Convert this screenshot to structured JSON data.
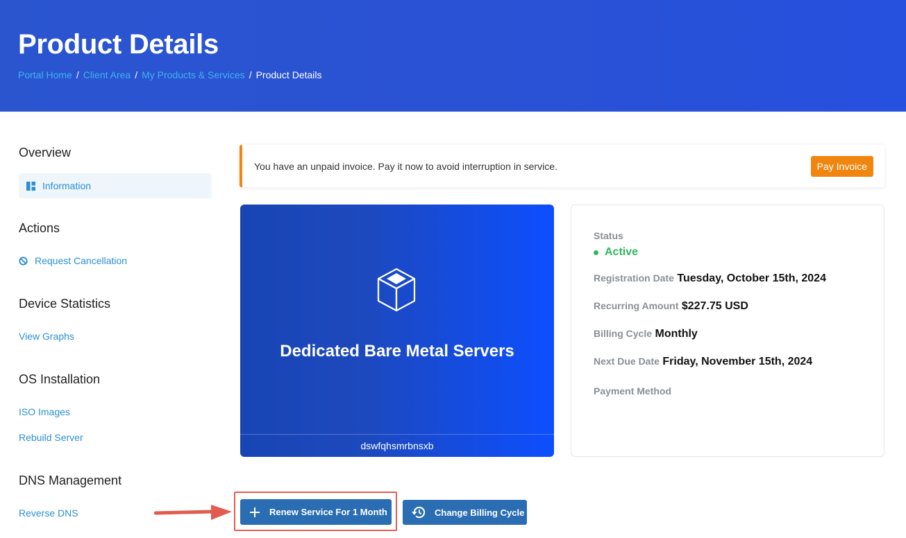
{
  "header": {
    "title": "Product Details",
    "breadcrumb": {
      "links": [
        "Portal Home",
        "Client Area",
        "My Products & Services"
      ],
      "current": "Product Details",
      "separator": "/"
    }
  },
  "sidebar": {
    "overview": {
      "heading": "Overview",
      "items": [
        {
          "label": "Information",
          "icon": "dashboard-icon"
        }
      ]
    },
    "actions": {
      "heading": "Actions",
      "items": [
        {
          "label": "Request Cancellation",
          "icon": "ban-icon"
        }
      ]
    },
    "device_statistics": {
      "heading": "Device Statistics",
      "items": [
        {
          "label": "View Graphs"
        }
      ]
    },
    "os_installation": {
      "heading": "OS Installation",
      "items": [
        {
          "label": "ISO Images"
        },
        {
          "label": "Rebuild Server"
        }
      ]
    },
    "dns_management": {
      "heading": "DNS Management",
      "items": [
        {
          "label": "Reverse DNS"
        }
      ]
    }
  },
  "alert": {
    "message": "You have an unpaid invoice. Pay it now to avoid interruption in service.",
    "button_label": "Pay Invoice",
    "accent_color": "#f0860f"
  },
  "product": {
    "name": "Dedicated Bare Metal Servers",
    "hostname": "dswfqhsmrbnsxb",
    "icon": "cube-icon"
  },
  "details": {
    "status_label": "Status",
    "status_value": "Active",
    "status_color": "#2eb85c",
    "registration_label": "Registration Date",
    "registration_value": "Tuesday, October 15th, 2024",
    "recurring_label": "Recurring Amount",
    "recurring_value": "$227.75 USD",
    "billing_cycle_label": "Billing Cycle",
    "billing_cycle_value": "Monthly",
    "next_due_label": "Next Due Date",
    "next_due_value": "Friday, November 15th, 2024",
    "payment_method_label": "Payment Method"
  },
  "buttons": {
    "renew_label": "Renew Service For 1 Month",
    "change_billing_label": "Change Billing Cycle"
  },
  "colors": {
    "header_bg": "#2a55cf",
    "link": "#2b8fd1",
    "button": "#2a6db3",
    "highlight": "#e25b4f"
  }
}
